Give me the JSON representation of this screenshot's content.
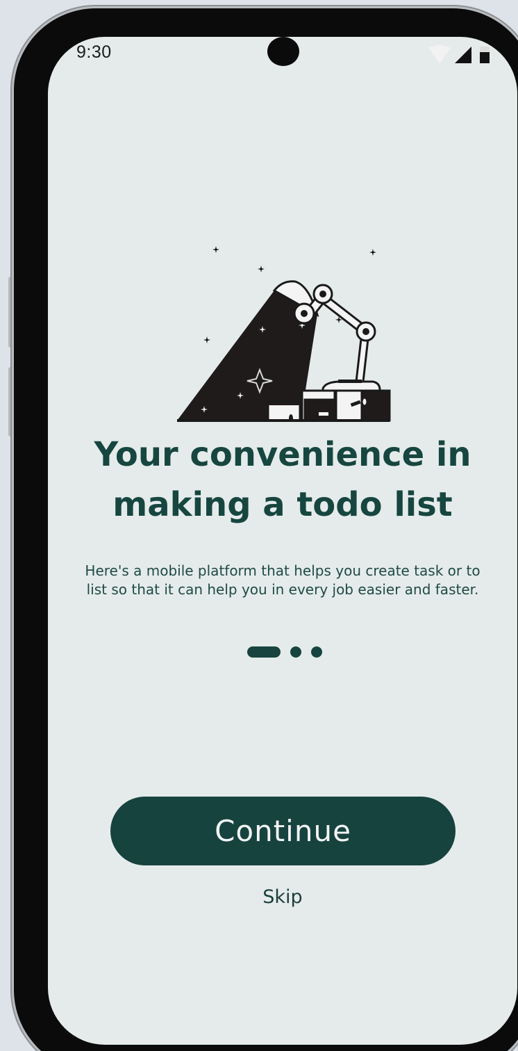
{
  "status_bar": {
    "time": "9:30",
    "icons": [
      "wifi-icon",
      "signal-icon",
      "battery-icon"
    ]
  },
  "onboarding": {
    "illustration": "robot-lamp-boxes-illustration",
    "title_line1": "Your convenience in",
    "title_line2": "making a todo list",
    "description": "Here's a mobile platform that helps you create task or to list so that it can help you in every job easier and faster.",
    "page_indicator": {
      "total": 3,
      "current": 1
    },
    "continue_label": "Continue",
    "skip_label": "Skip"
  },
  "colors": {
    "primary": "#17433f",
    "screen_background": "#e5ebeb",
    "page_background": "#dde3e9"
  }
}
